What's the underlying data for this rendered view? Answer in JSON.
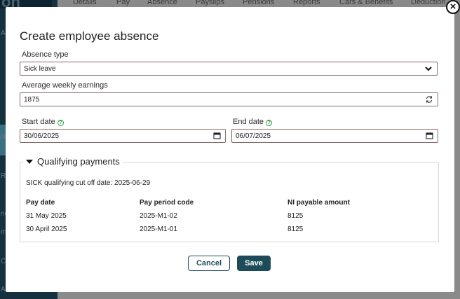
{
  "background": {
    "tabs": [
      "Details",
      "Pay",
      "Absence",
      "Payslips",
      "Pensions",
      "Reports",
      "Cars & Benefits",
      "Deduction"
    ],
    "sidebar_labels": [
      "A",
      "ol",
      "R",
      "ne",
      "m",
      "C",
      "Ac"
    ]
  },
  "modal": {
    "title": "Create employee absence",
    "absence_type": {
      "label": "Absence type",
      "value": "Sick leave"
    },
    "weekly_earnings": {
      "label": "Average weekly earnings",
      "value": "1875"
    },
    "start_date": {
      "label": "Start date",
      "value": "30/06/2025"
    },
    "end_date": {
      "label": "End date",
      "value": "06/07/2025"
    },
    "qualifying": {
      "legend": "Qualifying payments",
      "cutoff_text": "SICK qualifying cut off date: 2025-06-29",
      "headers": [
        "Pay date",
        "Pay period code",
        "NI payable amount"
      ],
      "rows": [
        [
          "31 May 2025",
          "2025-M1-02",
          "8125"
        ],
        [
          "30 April 2025",
          "2025-M1-01",
          "8125"
        ]
      ]
    },
    "cancel_label": "Cancel",
    "save_label": "Save"
  }
}
